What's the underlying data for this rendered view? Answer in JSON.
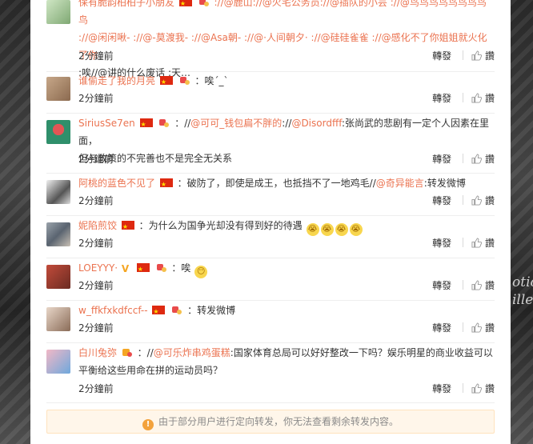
{
  "background": {
    "ghost_text_1": "otic",
    "ghost_text_2": "ille"
  },
  "comments": [
    {
      "username": "保有脆韵柏柏子小朋友",
      "parts_line1": "://@鹿山://@火宅公务员://@插队的小芸 ://@鸟鸟鸟鸟鸟鸟鸟鸟鸟",
      "line2": "://@闲闲啾- ://@-莫渡我- ://@Asa朝- ://@·人间朝夕· ://@硅硅雀雀 ://@感化不了你姐姐就火化了你",
      "line3": ":唉//@讲的什么废话 :天…",
      "time": "2分鐘前"
    },
    {
      "username": "谁偷走了我的月亮",
      "text": "：唉ˊ_ˋ",
      "time": "2分鐘前"
    },
    {
      "username": "SiriusSe7en",
      "text_a": "：//",
      "mention1": "@可可_钱包扁不胖的",
      "text_b": "://",
      "mention2": "@Disordfff",
      "text_c": ":张尚武的悲剧有一定个人因素在里面，",
      "line2": "但与政策的不完善也不是完全无关系",
      "time": "2分鐘前"
    },
    {
      "username": "阿桃的蓝色不见了",
      "text_a": "：破防了，即使是成王，也抵挡不了一地鸡毛//",
      "mention1": "@奇异能言",
      "text_b": ":转发微博",
      "time": "2分鐘前"
    },
    {
      "username": "妮陷煎饺",
      "text": "：为什么为国争光却没有得到好的待遇",
      "time": "2分鐘前"
    },
    {
      "username": "LOEYYY·",
      "text": "：唉",
      "time": "2分鐘前"
    },
    {
      "username": "w_ffkfxkdfccf--",
      "text": "：转发微博",
      "time": "2分鐘前"
    },
    {
      "username": "白川兔弥",
      "text_a": "：//",
      "mention1": "@可乐炸串鸡蛋糕",
      "text_b": ":国家体育总局可以好好整改一下吗？娱乐明星的商业收益可以",
      "line2": "平衡给这些用命在拼的运动员吗？",
      "time": "2分鐘前"
    }
  ],
  "actions": {
    "forward": "轉發",
    "like": "讚"
  },
  "notice": {
    "text": "由于部分用户进行定向转发，你无法查看剩余转发内容。"
  },
  "colors": {
    "link": "#eb7350",
    "notice_bg": "#fff6ea",
    "warn": "#f3a23c"
  }
}
